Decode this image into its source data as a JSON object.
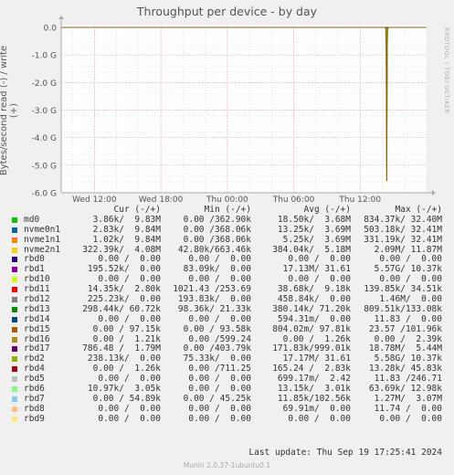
{
  "chart_data": {
    "type": "line",
    "title": "Throughput per device - by day",
    "ylabel": "Bytes/second read (-) / write (+)",
    "side_label": "RRDTOOL / TOBI OETIKER",
    "ylim": [
      -6.0,
      0.1
    ],
    "yticks": [
      {
        "v": 0,
        "label": "0.0"
      },
      {
        "v": -1,
        "label": "-1.0 G"
      },
      {
        "v": -2,
        "label": "-2.0 G"
      },
      {
        "v": -3,
        "label": "-3.0 G"
      },
      {
        "v": -4,
        "label": "-4.0 G"
      },
      {
        "v": -5,
        "label": "-5.0 G"
      },
      {
        "v": -6,
        "label": "-6.0 G"
      }
    ],
    "xlim": [
      0,
      33
    ],
    "xticks": [
      {
        "v": 3,
        "label": "Wed 12:00"
      },
      {
        "v": 9,
        "label": "Wed 18:00"
      },
      {
        "v": 15,
        "label": "Thu 00:00"
      },
      {
        "v": 21,
        "label": "Thu 06:00"
      },
      {
        "v": 27,
        "label": "Thu 12:00"
      }
    ],
    "series": [
      {
        "name": "rbd2",
        "color": "#88b010",
        "points": [
          [
            0,
            0
          ],
          [
            29.25,
            0
          ],
          [
            29.3,
            -0.05
          ],
          [
            29.35,
            -0.9
          ],
          [
            29.4,
            -5.58
          ],
          [
            29.45,
            -0.7
          ],
          [
            29.5,
            -0.05
          ],
          [
            29.55,
            0
          ],
          [
            33,
            0
          ]
        ]
      },
      {
        "name": "rbd1",
        "color": "#886000",
        "points": [
          [
            0,
            0
          ],
          [
            29.3,
            0
          ],
          [
            29.35,
            -0.05
          ],
          [
            29.4,
            -5.57
          ],
          [
            29.45,
            -0.05
          ],
          [
            29.5,
            0
          ],
          [
            33,
            0
          ]
        ]
      }
    ]
  },
  "legend": {
    "headers": [
      "Cur (-/+)",
      "Min (-/+)",
      "Avg (-/+)",
      "Max (-/+)"
    ],
    "rows": [
      {
        "name": "md0",
        "color": "#00cc00",
        "cur": "3.86k/  9.83M",
        "min": "0.00 /362.90k",
        "avg": "18.50k/  3.68M",
        "max": "834.37k/ 32.40M"
      },
      {
        "name": "nvme0n1",
        "color": "#0066b3",
        "cur": "2.83k/  9.84M",
        "min": "0.00 /368.06k",
        "avg": "13.25k/  3.69M",
        "max": "503.18k/ 32.41M"
      },
      {
        "name": "nvme1n1",
        "color": "#ff8000",
        "cur": "1.02k/  9.84M",
        "min": "0.00 /368.06k",
        "avg": "5.25k/  3.69M",
        "max": "331.19k/ 32.41M"
      },
      {
        "name": "nvme2n1",
        "color": "#ffcc00",
        "cur": "322.39k/  4.08M",
        "min": "42.80k/663.46k",
        "avg": "384.04k/  5.18M",
        "max": "2.09M/ 11.87M"
      },
      {
        "name": "rbd0",
        "color": "#330099",
        "cur": "0.00 /  0.00",
        "min": "0.00 /  0.00",
        "avg": "0.00 /  0.00",
        "max": "0.00 /  0.00"
      },
      {
        "name": "rbd1",
        "color": "#990099",
        "cur": "195.52k/  0.00",
        "min": "83.09k/  0.00",
        "avg": "17.13M/ 31.61",
        "max": "5.57G/ 10.37k"
      },
      {
        "name": "rbd10",
        "color": "#ccff00",
        "cur": "0.00 /  0.00",
        "min": "0.00 /  0.00",
        "avg": "0.00 /  0.00",
        "max": "0.00 /  0.00"
      },
      {
        "name": "rbd11",
        "color": "#ff0000",
        "cur": "14.35k/  2.80k",
        "min": "1021.43 /253.69",
        "avg": "38.68k/  9.18k",
        "max": "139.85k/ 34.51k"
      },
      {
        "name": "rbd12",
        "color": "#808080",
        "cur": "225.23k/  0.00",
        "min": "193.83k/  0.00",
        "avg": "458.84k/  0.00",
        "max": "1.46M/  0.00"
      },
      {
        "name": "rbd13",
        "color": "#008f00",
        "cur": "298.44k/ 60.72k",
        "min": "98.36k/ 21.33k",
        "avg": "380.14k/ 71.20k",
        "max": "809.51k/133.08k"
      },
      {
        "name": "rbd14",
        "color": "#00487d",
        "cur": "0.00 /  0.00",
        "min": "0.00 /  0.00",
        "avg": "594.31m/  0.00",
        "max": "11.83 /  0.00"
      },
      {
        "name": "rbd15",
        "color": "#b35a00",
        "cur": "0.00 / 97.15k",
        "min": "0.00 / 93.58k",
        "avg": "804.02m/ 97.81k",
        "max": "23.57 /101.96k"
      },
      {
        "name": "rbd16",
        "color": "#b38f00",
        "cur": "0.00 /  1.21k",
        "min": "0.00 /599.24",
        "avg": "0.00 /  1.26k",
        "max": "0.00 /  2.39k"
      },
      {
        "name": "rbd17",
        "color": "#6b006b",
        "cur": "786.48 /  1.79M",
        "min": "0.00 /403.79k",
        "avg": "171.83k/999.01k",
        "max": "18.78M/  5.44M"
      },
      {
        "name": "rbd2",
        "color": "#8fb300",
        "cur": "238.13k/  0.00",
        "min": "75.33k/  0.00",
        "avg": "17.17M/ 31.61",
        "max": "5.58G/ 10.37k"
      },
      {
        "name": "rbd4",
        "color": "#b30000",
        "cur": "0.00 /  1.26k",
        "min": "0.00 /711.25",
        "avg": "165.24 /  2.83k",
        "max": "13.28k/ 45.83k"
      },
      {
        "name": "rbd5",
        "color": "#bebebe",
        "cur": "0.00 /  0.00",
        "min": "0.00 /  0.00",
        "avg": "699.17m/  2.42",
        "max": "11.83 /246.71"
      },
      {
        "name": "rbd6",
        "color": "#80ff80",
        "cur": "10.97k/  3.05k",
        "min": "0.00 /  0.00",
        "avg": "13.15k/  3.01k",
        "max": "63.69k/ 12.98k"
      },
      {
        "name": "rbd7",
        "color": "#80c9ff",
        "cur": "0.00 / 54.89k",
        "min": "0.00 / 45.25k",
        "avg": "11.85k/102.56k",
        "max": "1.27M/  3.07M"
      },
      {
        "name": "rbd8",
        "color": "#ffc080",
        "cur": "0.00 /  0.00",
        "min": "0.00 /  0.00",
        "avg": "69.91m/  0.00",
        "max": "11.74 /  0.00"
      },
      {
        "name": "rbd9",
        "color": "#ffe680",
        "cur": "0.00 /  0.00",
        "min": "0.00 /  0.00",
        "avg": "0.00 /  0.00",
        "max": "0.00 /  0.00"
      }
    ]
  },
  "last_update": "Last update: Thu Sep 19 17:25:41 2024",
  "footer": "Munin 2.0.37-1ubuntu0.1"
}
